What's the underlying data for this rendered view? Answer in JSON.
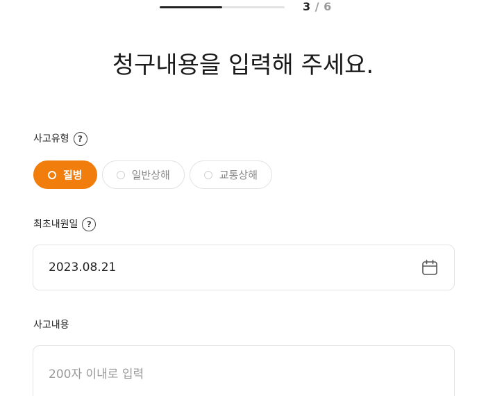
{
  "progress": {
    "current": "3",
    "separator": "/",
    "total": "6",
    "fraction": 0.5
  },
  "title": "청구내용을 입력해 주세요.",
  "accident_type": {
    "label": "사고유형",
    "help": "?",
    "options": [
      {
        "label": "질병",
        "selected": true
      },
      {
        "label": "일반상해",
        "selected": false
      },
      {
        "label": "교통상해",
        "selected": false
      }
    ]
  },
  "first_visit": {
    "label": "최초내원일",
    "help": "?",
    "value": "2023.08.21",
    "icon": "calendar-icon"
  },
  "accident_content": {
    "label": "사고내용",
    "placeholder": "200자 이내로 입력"
  },
  "colors": {
    "accent": "#f07d0c",
    "progress_fill": "#222222",
    "progress_track": "#e3e3e3"
  }
}
